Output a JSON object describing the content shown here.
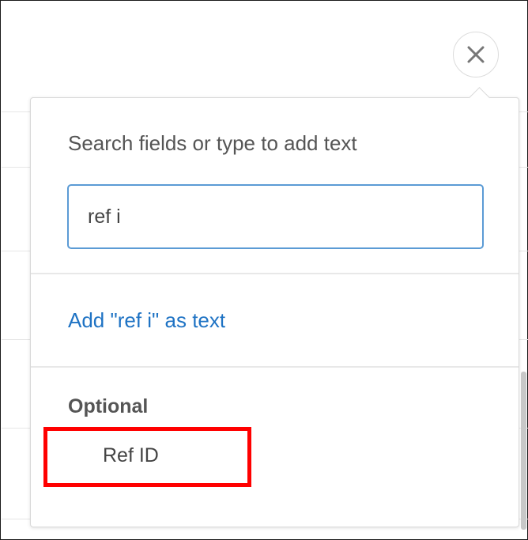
{
  "picker": {
    "instruction": "Search fields or type to add text",
    "search_value": "ref i",
    "add_as_text_label": "Add \"ref i\" as text",
    "section_label": "Optional",
    "options": [
      {
        "label": "Ref ID"
      }
    ]
  },
  "icons": {
    "close": "close-icon"
  },
  "colors": {
    "link": "#1f73c4",
    "input_focus_border": "#5b9bd5",
    "highlight": "#ff0000"
  }
}
